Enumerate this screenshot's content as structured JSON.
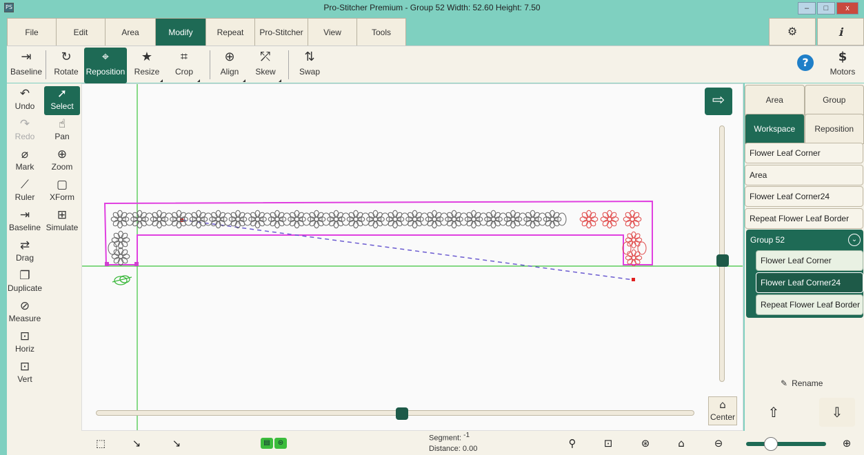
{
  "window": {
    "app_icon": "PS",
    "title": "Pro-Stitcher Premium  -  Group 52  Width: 52.60  Height: 7.50",
    "controls": [
      "–",
      "□",
      "x"
    ]
  },
  "menu": {
    "tabs": [
      "File",
      "Edit",
      "Area",
      "Modify",
      "Repeat",
      "Pro-Stitcher",
      "View",
      "Tools"
    ],
    "active_tab": "Modify",
    "right_icons": [
      {
        "name": "gear-icon",
        "glyph": "⚙"
      },
      {
        "name": "info-icon",
        "glyph": "ℹ"
      }
    ]
  },
  "toolbar": {
    "baseline": "Baseline",
    "rotate": "Rotate",
    "reposition": "Reposition",
    "resize": "Resize",
    "crop": "Crop",
    "align": "Align",
    "skew": "Skew",
    "swap": "Swap",
    "help_glyph": "?",
    "motors": "Motors",
    "motors_glyph": "$"
  },
  "left_tools": {
    "undo": "Undo",
    "select": "Select",
    "redo": "Redo",
    "pan": "Pan",
    "mark": "Mark",
    "zoom": "Zoom",
    "ruler": "Ruler",
    "xform": "XForm",
    "baseline": "Baseline",
    "simulate": "Simulate",
    "drag": "Drag",
    "duplicate": "Duplicate",
    "measure": "Measure",
    "horiz": "Horiz",
    "vert": "Vert"
  },
  "canvas": {
    "center_label": "Center",
    "arrow_glyph": "⇨",
    "vertical_slider_position": 0.51,
    "horizontal_slider_position": 0.51
  },
  "right_panel": {
    "tabs_top": [
      "Area",
      "Group"
    ],
    "tabs_bottom": [
      "Workspace",
      "Reposition"
    ],
    "active_tab": "Workspace",
    "items": [
      "Flower Leaf Corner",
      "Area",
      "Flower Leaf Corner24",
      "Repeat Flower Leaf Border"
    ],
    "group": {
      "label": "Group 52",
      "toggle_glyph": "⌄",
      "children": [
        "Flower Leaf Corner",
        "Flower Leaf Corner24",
        "Repeat Flower Leaf Border"
      ],
      "selected_child": "Flower Leaf Corner24"
    },
    "rename": "Rename",
    "up_glyph": "⇧",
    "down_glyph": "⇩"
  },
  "bottom_bar": {
    "segment_label": "Segment:",
    "segment_value": "-1",
    "distance_label": "Distance:",
    "distance_value": "0.00",
    "zoom_level": 0.3
  }
}
